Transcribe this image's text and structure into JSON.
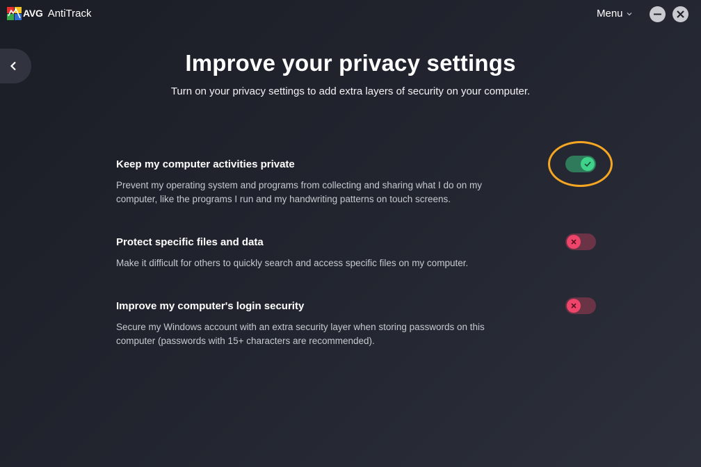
{
  "app": {
    "brand": "AVG",
    "product": "AntiTrack",
    "menu_label": "Menu"
  },
  "page": {
    "title": "Improve your privacy settings",
    "subtitle": "Turn on your privacy settings to add extra layers of security on your computer."
  },
  "settings": [
    {
      "title": "Keep my computer activities private",
      "description": "Prevent my operating system and programs from collecting and sharing what I do on my computer, like the programs I run and my handwriting patterns on touch screens.",
      "enabled": true
    },
    {
      "title": "Protect specific files and data",
      "description": "Make it difficult for others to quickly search and access specific files on my computer.",
      "enabled": false
    },
    {
      "title": "Improve my computer's login security",
      "description": "Secure my Windows account with an extra security layer when storing passwords on this computer (passwords with 15+ characters are recommended).",
      "enabled": false
    }
  ],
  "colors": {
    "toggle_on": "#3ed28a",
    "toggle_off": "#f0456a",
    "highlight": "#f5a623"
  }
}
